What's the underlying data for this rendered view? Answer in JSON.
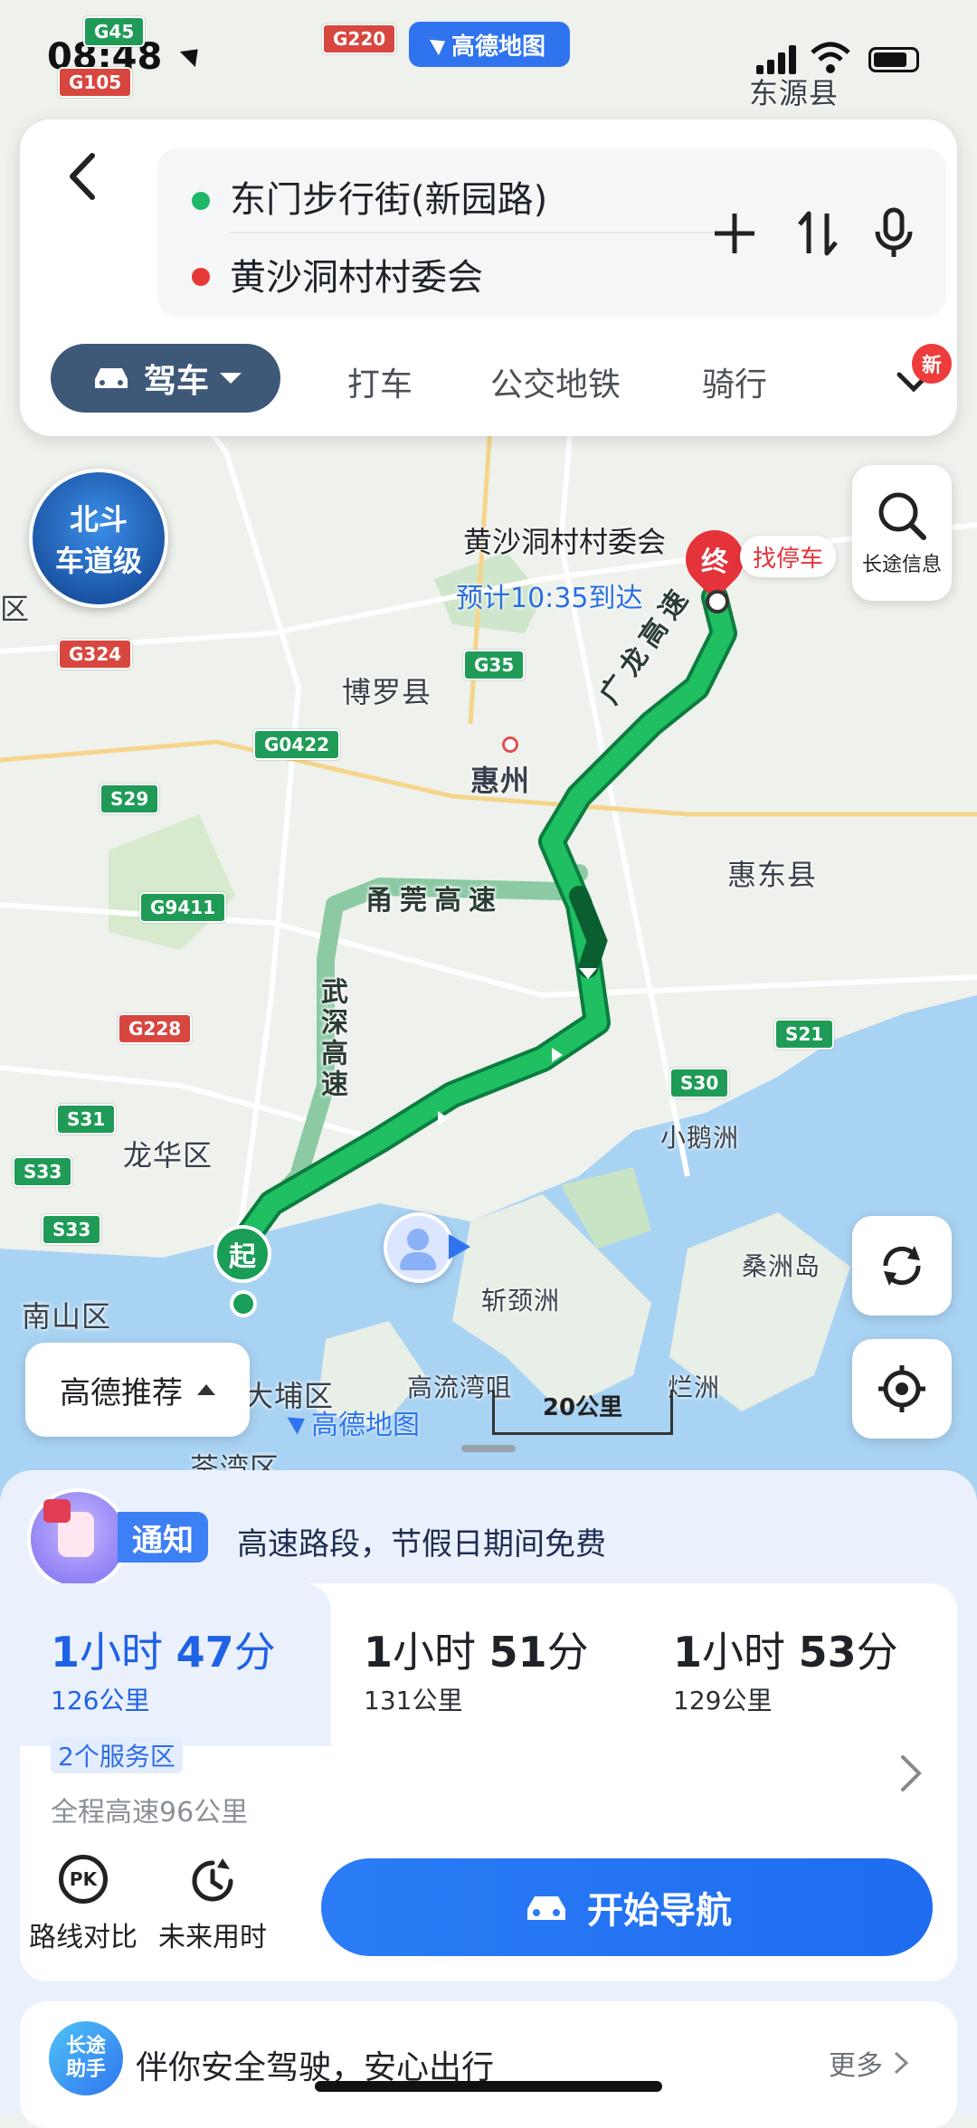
{
  "status_bar": {
    "time": "08:48"
  },
  "map": {
    "top_logo": "高德地图",
    "beidou_line1": "北斗",
    "beidou_line2": "车道级",
    "destination_name": "黄沙洞村村委会",
    "eta": "预计10:35到达",
    "end_marker": "终",
    "start_marker": "起",
    "find_parking": "找停车",
    "long_trip_info": "长途信息",
    "watermark": "高德地图",
    "scale": "20公里",
    "labels": [
      "东源县",
      "博罗县",
      "惠州",
      "惠东县",
      "龙华区",
      "南山区",
      "大埔区",
      "荃湾区",
      "小鹅洲",
      "桑洲岛",
      "斩颈洲",
      "高流湾咀",
      "烂洲",
      "区"
    ],
    "highways": [
      "广龙高速",
      "甬莞高速",
      "武深高速"
    ],
    "badges_green": [
      "G45",
      "G35",
      "G0422",
      "S29",
      "G9411",
      "S31",
      "S33",
      "S33",
      "S21",
      "S30"
    ],
    "badges_red": [
      "G105",
      "G220",
      "G324",
      "G228"
    ],
    "recommend": "高德推荐"
  },
  "top_card": {
    "origin": "东门步行街(新园路)",
    "destination": "黄沙洞村村委会",
    "mode_drive": "驾车",
    "modes": [
      "打车",
      "公交地铁",
      "骑行"
    ],
    "new_badge": "新",
    "colors": {
      "origin_dot": "#1fb86a",
      "dest_dot": "#e53935"
    }
  },
  "notice": {
    "tag": "通知",
    "text": "高速路段，节假日期间免费"
  },
  "routes": [
    {
      "hours": "1",
      "h_unit": "小时",
      "mins": "47",
      "m_unit": "分",
      "distance": "126公里"
    },
    {
      "hours": "1",
      "h_unit": "小时",
      "mins": "51",
      "m_unit": "分",
      "distance": "131公里"
    },
    {
      "hours": "1",
      "h_unit": "小时",
      "mins": "53",
      "m_unit": "分",
      "distance": "129公里"
    }
  ],
  "route_detail": {
    "service_badge": "2个服务区",
    "highway_info": "全程高速96公里"
  },
  "actions": {
    "compare": "路线对比",
    "future": "未来用时",
    "pk": "PK",
    "start_nav": "开始导航"
  },
  "helper": {
    "icon_line1": "长途",
    "icon_line2": "助手",
    "text": "伴你安全驾驶，安心出行",
    "more": "更多"
  }
}
